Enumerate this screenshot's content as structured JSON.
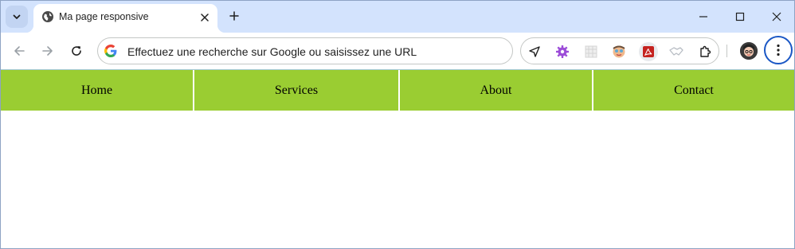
{
  "browser": {
    "tab": {
      "title": "Ma page responsive"
    },
    "omnibox": {
      "placeholder": "Effectuez une recherche sur Google ou saisissez une URL"
    },
    "icons": [
      "tab-search-icon",
      "globe-icon",
      "close-icon",
      "plus-icon",
      "minimize-icon",
      "maximize-icon",
      "window-close-icon",
      "back-arrow-icon",
      "forward-arrow-icon",
      "reload-icon",
      "google-logo-icon",
      "extension-icons",
      "puzzle-icon",
      "avatar",
      "kebab-menu-icon"
    ],
    "colors": {
      "tabstrip": "#d3e3fd",
      "focus_ring": "#1a57c5"
    }
  },
  "page": {
    "nav": {
      "items": [
        {
          "label": "Home"
        },
        {
          "label": "Services"
        },
        {
          "label": "About"
        },
        {
          "label": "Contact"
        }
      ],
      "background": "#9acd32"
    }
  }
}
